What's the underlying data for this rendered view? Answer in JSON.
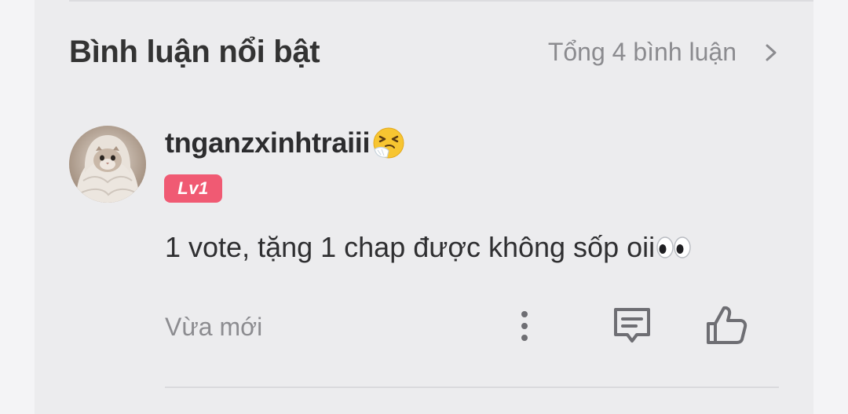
{
  "section": {
    "title": "Bình luận nổi bật",
    "total_label": "Tổng 4 bình luận",
    "chevron_icon": "chevron-right-icon"
  },
  "comment": {
    "username": "tnganzxinhtraiii",
    "username_emoji_icon": "sneezing-face-icon",
    "level_badge": "Lv1",
    "level_badge_color": "#f05a73",
    "text": "1 vote, tặng 1 chap được không sốp oii",
    "text_emoji_icon": "eyes-icon",
    "timestamp": "Vừa mới",
    "actions": {
      "more_icon": "more-vertical-icon",
      "reply_icon": "comment-icon",
      "like_icon": "thumbs-up-icon"
    }
  },
  "colors": {
    "panel_background": "#ececee",
    "title_text": "#333333",
    "secondary_text": "#8b8b8f"
  }
}
